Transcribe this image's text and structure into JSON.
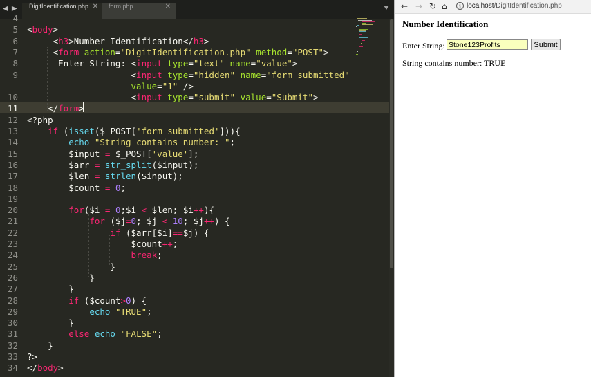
{
  "editor": {
    "tabs": [
      {
        "label": "DigitIdentification.php",
        "active": true
      },
      {
        "label": "form.php",
        "active": false
      }
    ],
    "current_line": 11,
    "lines": [
      {
        "n": "4",
        "tokens": []
      },
      {
        "n": "5",
        "tokens": [
          [
            "t-var",
            "<"
          ],
          [
            "t-tag",
            "body"
          ],
          [
            "t-var",
            ">"
          ]
        ]
      },
      {
        "n": "6",
        "tokens": [
          [
            "t-var",
            "     <"
          ],
          [
            "t-tag",
            "h3"
          ],
          [
            "t-var",
            ">Number Identification</"
          ],
          [
            "t-tag",
            "h3"
          ],
          [
            "t-var",
            ">"
          ]
        ]
      },
      {
        "n": "7",
        "tokens": [
          [
            "t-var",
            "     <"
          ],
          [
            "t-tag",
            "form"
          ],
          [
            "t-var",
            " "
          ],
          [
            "t-attr",
            "action"
          ],
          [
            "t-var",
            "="
          ],
          [
            "t-str",
            "\"DigitIdentification.php\""
          ],
          [
            "t-var",
            " "
          ],
          [
            "t-attr",
            "method"
          ],
          [
            "t-var",
            "="
          ],
          [
            "t-str",
            "\"POST\""
          ],
          [
            "t-var",
            ">"
          ]
        ]
      },
      {
        "n": "8",
        "tokens": [
          [
            "t-var",
            "      Enter String: <"
          ],
          [
            "t-tag",
            "input"
          ],
          [
            "t-var",
            " "
          ],
          [
            "t-attr",
            "type"
          ],
          [
            "t-var",
            "="
          ],
          [
            "t-str",
            "\"text\""
          ],
          [
            "t-var",
            " "
          ],
          [
            "t-attr",
            "name"
          ],
          [
            "t-var",
            "="
          ],
          [
            "t-str",
            "\"value\""
          ],
          [
            "t-var",
            ">"
          ]
        ]
      },
      {
        "n": "9",
        "tokens": [
          [
            "t-var",
            "                    <"
          ],
          [
            "t-tag",
            "input"
          ],
          [
            "t-var",
            " "
          ],
          [
            "t-attr",
            "type"
          ],
          [
            "t-var",
            "="
          ],
          [
            "t-str",
            "\"hidden\""
          ],
          [
            "t-var",
            " "
          ],
          [
            "t-attr",
            "name"
          ],
          [
            "t-var",
            "="
          ],
          [
            "t-str",
            "\"form_submitted\""
          ]
        ]
      },
      {
        "n": "",
        "tokens": [
          [
            "t-var",
            "                    "
          ],
          [
            "t-attr",
            "value"
          ],
          [
            "t-var",
            "="
          ],
          [
            "t-str",
            "\"1\""
          ],
          [
            "t-var",
            " />"
          ]
        ]
      },
      {
        "n": "10",
        "tokens": [
          [
            "t-var",
            "                    <"
          ],
          [
            "t-tag",
            "input"
          ],
          [
            "t-var",
            " "
          ],
          [
            "t-attr",
            "type"
          ],
          [
            "t-var",
            "="
          ],
          [
            "t-str",
            "\"submit\""
          ],
          [
            "t-var",
            " "
          ],
          [
            "t-attr",
            "value"
          ],
          [
            "t-var",
            "="
          ],
          [
            "t-str",
            "\"Submit\""
          ],
          [
            "t-var",
            ">"
          ]
        ]
      },
      {
        "n": "11",
        "tokens": [
          [
            "t-var",
            "    </"
          ],
          [
            "t-tag",
            "form"
          ],
          [
            "t-var",
            ">"
          ]
        ]
      },
      {
        "n": "12",
        "tokens": [
          [
            "t-var",
            "<?php"
          ]
        ]
      },
      {
        "n": "13",
        "tokens": [
          [
            "t-var",
            "    "
          ],
          [
            "t-kw",
            "if"
          ],
          [
            "t-var",
            " ("
          ],
          [
            "t-fn",
            "isset"
          ],
          [
            "t-var",
            "($_POST["
          ],
          [
            "t-str",
            "'form_submitted'"
          ],
          [
            "t-var",
            "])){"
          ]
        ]
      },
      {
        "n": "14",
        "tokens": [
          [
            "t-var",
            "        "
          ],
          [
            "t-fn",
            "echo"
          ],
          [
            "t-var",
            " "
          ],
          [
            "t-str",
            "\"String contains number: \""
          ],
          [
            "t-var",
            ";"
          ]
        ]
      },
      {
        "n": "15",
        "tokens": [
          [
            "t-var",
            "        $input "
          ],
          [
            "t-kw",
            "="
          ],
          [
            "t-var",
            " $_POST["
          ],
          [
            "t-str",
            "'value'"
          ],
          [
            "t-var",
            "];"
          ]
        ]
      },
      {
        "n": "16",
        "tokens": [
          [
            "t-var",
            "        $arr "
          ],
          [
            "t-kw",
            "="
          ],
          [
            "t-var",
            " "
          ],
          [
            "t-fn",
            "str_split"
          ],
          [
            "t-var",
            "($input);"
          ]
        ]
      },
      {
        "n": "17",
        "tokens": [
          [
            "t-var",
            "        $len "
          ],
          [
            "t-kw",
            "="
          ],
          [
            "t-var",
            " "
          ],
          [
            "t-fn",
            "strlen"
          ],
          [
            "t-var",
            "($input);"
          ]
        ]
      },
      {
        "n": "18",
        "tokens": [
          [
            "t-var",
            "        $count "
          ],
          [
            "t-kw",
            "="
          ],
          [
            "t-var",
            " "
          ],
          [
            "t-num",
            "0"
          ],
          [
            "t-var",
            ";"
          ]
        ]
      },
      {
        "n": "19",
        "tokens": []
      },
      {
        "n": "20",
        "tokens": [
          [
            "t-var",
            "        "
          ],
          [
            "t-kw",
            "for"
          ],
          [
            "t-var",
            "($i "
          ],
          [
            "t-kw",
            "="
          ],
          [
            "t-var",
            " "
          ],
          [
            "t-num",
            "0"
          ],
          [
            "t-var",
            ";$i "
          ],
          [
            "t-kw",
            "<"
          ],
          [
            "t-var",
            " $len; $i"
          ],
          [
            "t-kw",
            "++"
          ],
          [
            "t-var",
            "){"
          ]
        ]
      },
      {
        "n": "21",
        "tokens": [
          [
            "t-var",
            "            "
          ],
          [
            "t-kw",
            "for"
          ],
          [
            "t-var",
            " ($j"
          ],
          [
            "t-kw",
            "="
          ],
          [
            "t-num",
            "0"
          ],
          [
            "t-var",
            "; $j "
          ],
          [
            "t-kw",
            "<"
          ],
          [
            "t-var",
            " "
          ],
          [
            "t-num",
            "10"
          ],
          [
            "t-var",
            "; $j"
          ],
          [
            "t-kw",
            "++"
          ],
          [
            "t-var",
            ") {"
          ]
        ]
      },
      {
        "n": "22",
        "tokens": [
          [
            "t-var",
            "                "
          ],
          [
            "t-kw",
            "if"
          ],
          [
            "t-var",
            " ($arr[$i]"
          ],
          [
            "t-kw",
            "=="
          ],
          [
            "t-var",
            "$j) {"
          ]
        ]
      },
      {
        "n": "23",
        "tokens": [
          [
            "t-var",
            "                    $count"
          ],
          [
            "t-kw",
            "++"
          ],
          [
            "t-var",
            ";"
          ]
        ]
      },
      {
        "n": "24",
        "tokens": [
          [
            "t-var",
            "                    "
          ],
          [
            "t-kw",
            "break"
          ],
          [
            "t-var",
            ";"
          ]
        ]
      },
      {
        "n": "25",
        "tokens": [
          [
            "t-var",
            "                }"
          ]
        ]
      },
      {
        "n": "26",
        "tokens": [
          [
            "t-var",
            "            }"
          ]
        ]
      },
      {
        "n": "27",
        "tokens": [
          [
            "t-var",
            "        }"
          ]
        ]
      },
      {
        "n": "28",
        "tokens": [
          [
            "t-var",
            "        "
          ],
          [
            "t-kw",
            "if"
          ],
          [
            "t-var",
            " ($count"
          ],
          [
            "t-kw",
            ">"
          ],
          [
            "t-num",
            "0"
          ],
          [
            "t-var",
            ") {"
          ]
        ]
      },
      {
        "n": "29",
        "tokens": [
          [
            "t-var",
            "            "
          ],
          [
            "t-fn",
            "echo"
          ],
          [
            "t-var",
            " "
          ],
          [
            "t-str",
            "\"TRUE\""
          ],
          [
            "t-var",
            ";"
          ]
        ]
      },
      {
        "n": "30",
        "tokens": [
          [
            "t-var",
            "        }"
          ]
        ]
      },
      {
        "n": "31",
        "tokens": [
          [
            "t-var",
            "        "
          ],
          [
            "t-kw",
            "else"
          ],
          [
            "t-var",
            " "
          ],
          [
            "t-fn",
            "echo"
          ],
          [
            "t-var",
            " "
          ],
          [
            "t-str",
            "\"FALSE\""
          ],
          [
            "t-var",
            ";"
          ]
        ]
      },
      {
        "n": "32",
        "tokens": [
          [
            "t-var",
            "    }"
          ]
        ]
      },
      {
        "n": "33",
        "tokens": [
          [
            "t-var",
            "?>"
          ]
        ]
      },
      {
        "n": "34",
        "tokens": [
          [
            "t-var",
            "</"
          ],
          [
            "t-tag",
            "body"
          ],
          [
            "t-var",
            ">"
          ]
        ]
      }
    ]
  },
  "browser": {
    "url_host": "localhost",
    "url_path": "/DigitIdentification.php",
    "nav": {
      "back_icon": "arrow-left-icon",
      "forward_icon": "arrow-right-icon",
      "reload_icon": "reload-icon",
      "home_icon": "home-icon",
      "info_icon": "info-icon"
    },
    "page": {
      "heading": "Number Identification",
      "input_label": "Enter String:",
      "input_value": "Stone123Profits",
      "submit_label": "Submit",
      "result_text": "String contains number: TRUE"
    }
  }
}
